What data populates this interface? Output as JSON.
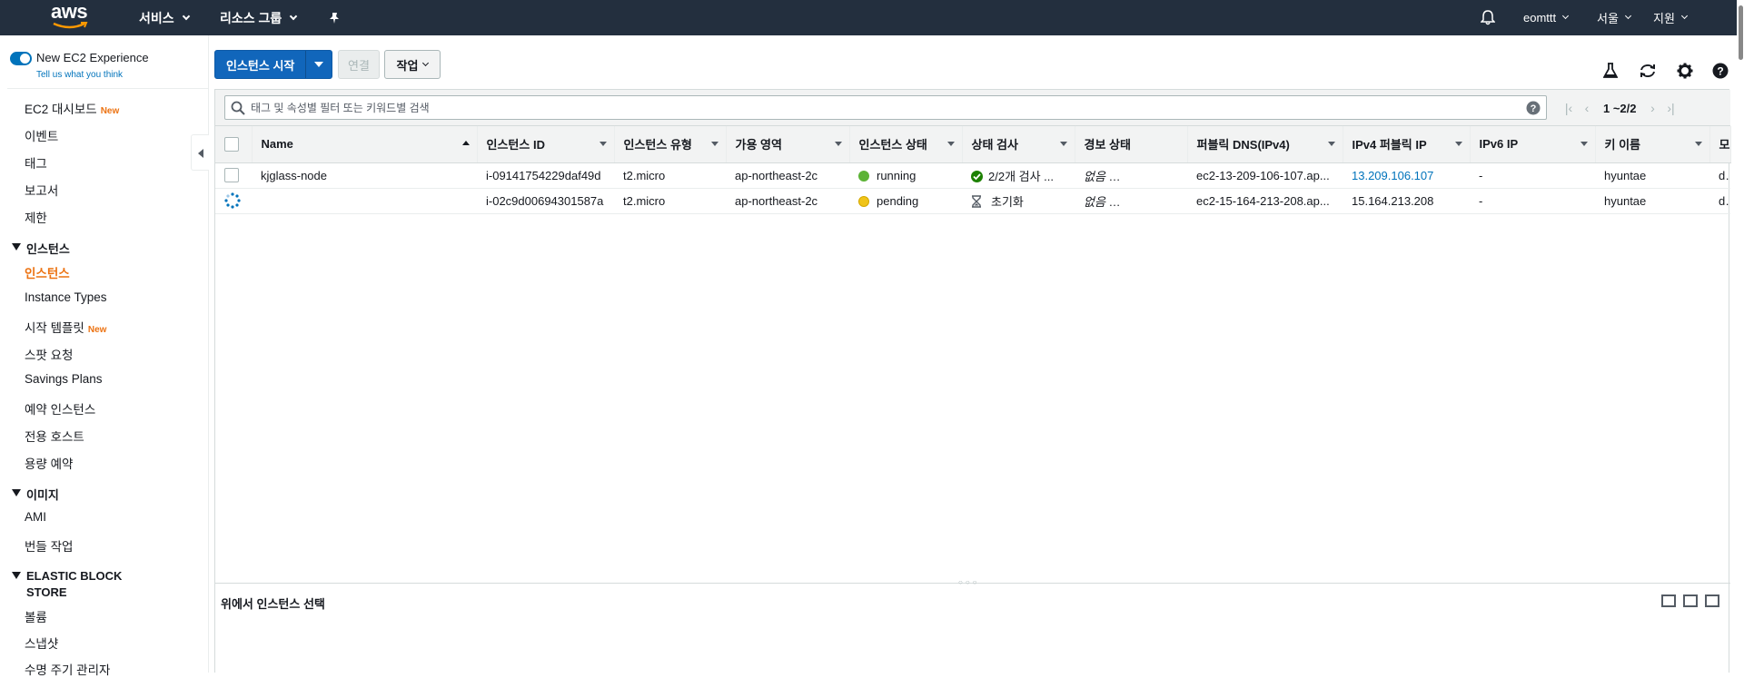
{
  "topnav": {
    "logo_text": "aws",
    "services": "서비스",
    "resource_groups": "리소스 그룹",
    "user": "eomttt",
    "region": "서울",
    "support": "지원"
  },
  "sidebar": {
    "new_experience": "New EC2 Experience",
    "tell_us": "Tell us what you think",
    "new_badge": "New",
    "items_top": [
      "EC2 대시보드",
      "이벤트",
      "태그",
      "보고서",
      "제한"
    ],
    "section_instances": "인스턴스",
    "instances_items": [
      "인스턴스",
      "Instance Types",
      "시작 템플릿",
      "스팟 요청",
      "Savings Plans",
      "예약 인스턴스",
      "전용 호스트",
      "용량 예약"
    ],
    "section_images": "이미지",
    "images_items": [
      "AMI",
      "번들 작업"
    ],
    "section_ebs": "ELASTIC BLOCK STORE",
    "ebs_items": [
      "볼륨",
      "스냅샷",
      "수명 주기 관리자"
    ]
  },
  "toolbar": {
    "launch": "인스턴스 시작",
    "connect": "연결",
    "actions": "작업"
  },
  "filter": {
    "placeholder": "태그 및 속성별 필터 또는 키워드별 검색",
    "pager": "1 ~2/2"
  },
  "table": {
    "columns": [
      "Name",
      "인스턴스 ID",
      "인스턴스 유형",
      "가용 영역",
      "인스턴스 상태",
      "상태 검사",
      "경보 상태",
      "퍼블릭 DNS(IPv4)",
      "IPv4 퍼블릭 IP",
      "IPv6 IP",
      "키 이름",
      "모니"
    ],
    "rows": [
      {
        "name": "kjglass-node",
        "id": "i-09141754229daf49d",
        "type": "t2.micro",
        "az": "ap-northeast-2c",
        "state": "running",
        "check": "2/2개 검사 ...",
        "alarm": "없음",
        "dns": "ec2-13-209-106-107.ap...",
        "ipv4": "13.209.106.107",
        "ipv6": "-",
        "key": "hyuntae",
        "mon": "disa"
      },
      {
        "name": "",
        "id": "i-02c9d00694301587a",
        "type": "t2.micro",
        "az": "ap-northeast-2c",
        "state": "pending",
        "check": "초기화",
        "alarm": "없음",
        "dns": "ec2-15-164-213-208.ap...",
        "ipv4": "15.164.213.208",
        "ipv6": "-",
        "key": "hyuntae",
        "mon": "disa"
      }
    ]
  },
  "detail": {
    "title": "위에서 인스턴스 선택"
  },
  "colors": {
    "nav_bg": "#232f3e",
    "primary": "#1166bb",
    "accent_orange": "#ec7211",
    "running": "#5cb336",
    "pending": "#f0c419",
    "link": "#0073bb"
  }
}
